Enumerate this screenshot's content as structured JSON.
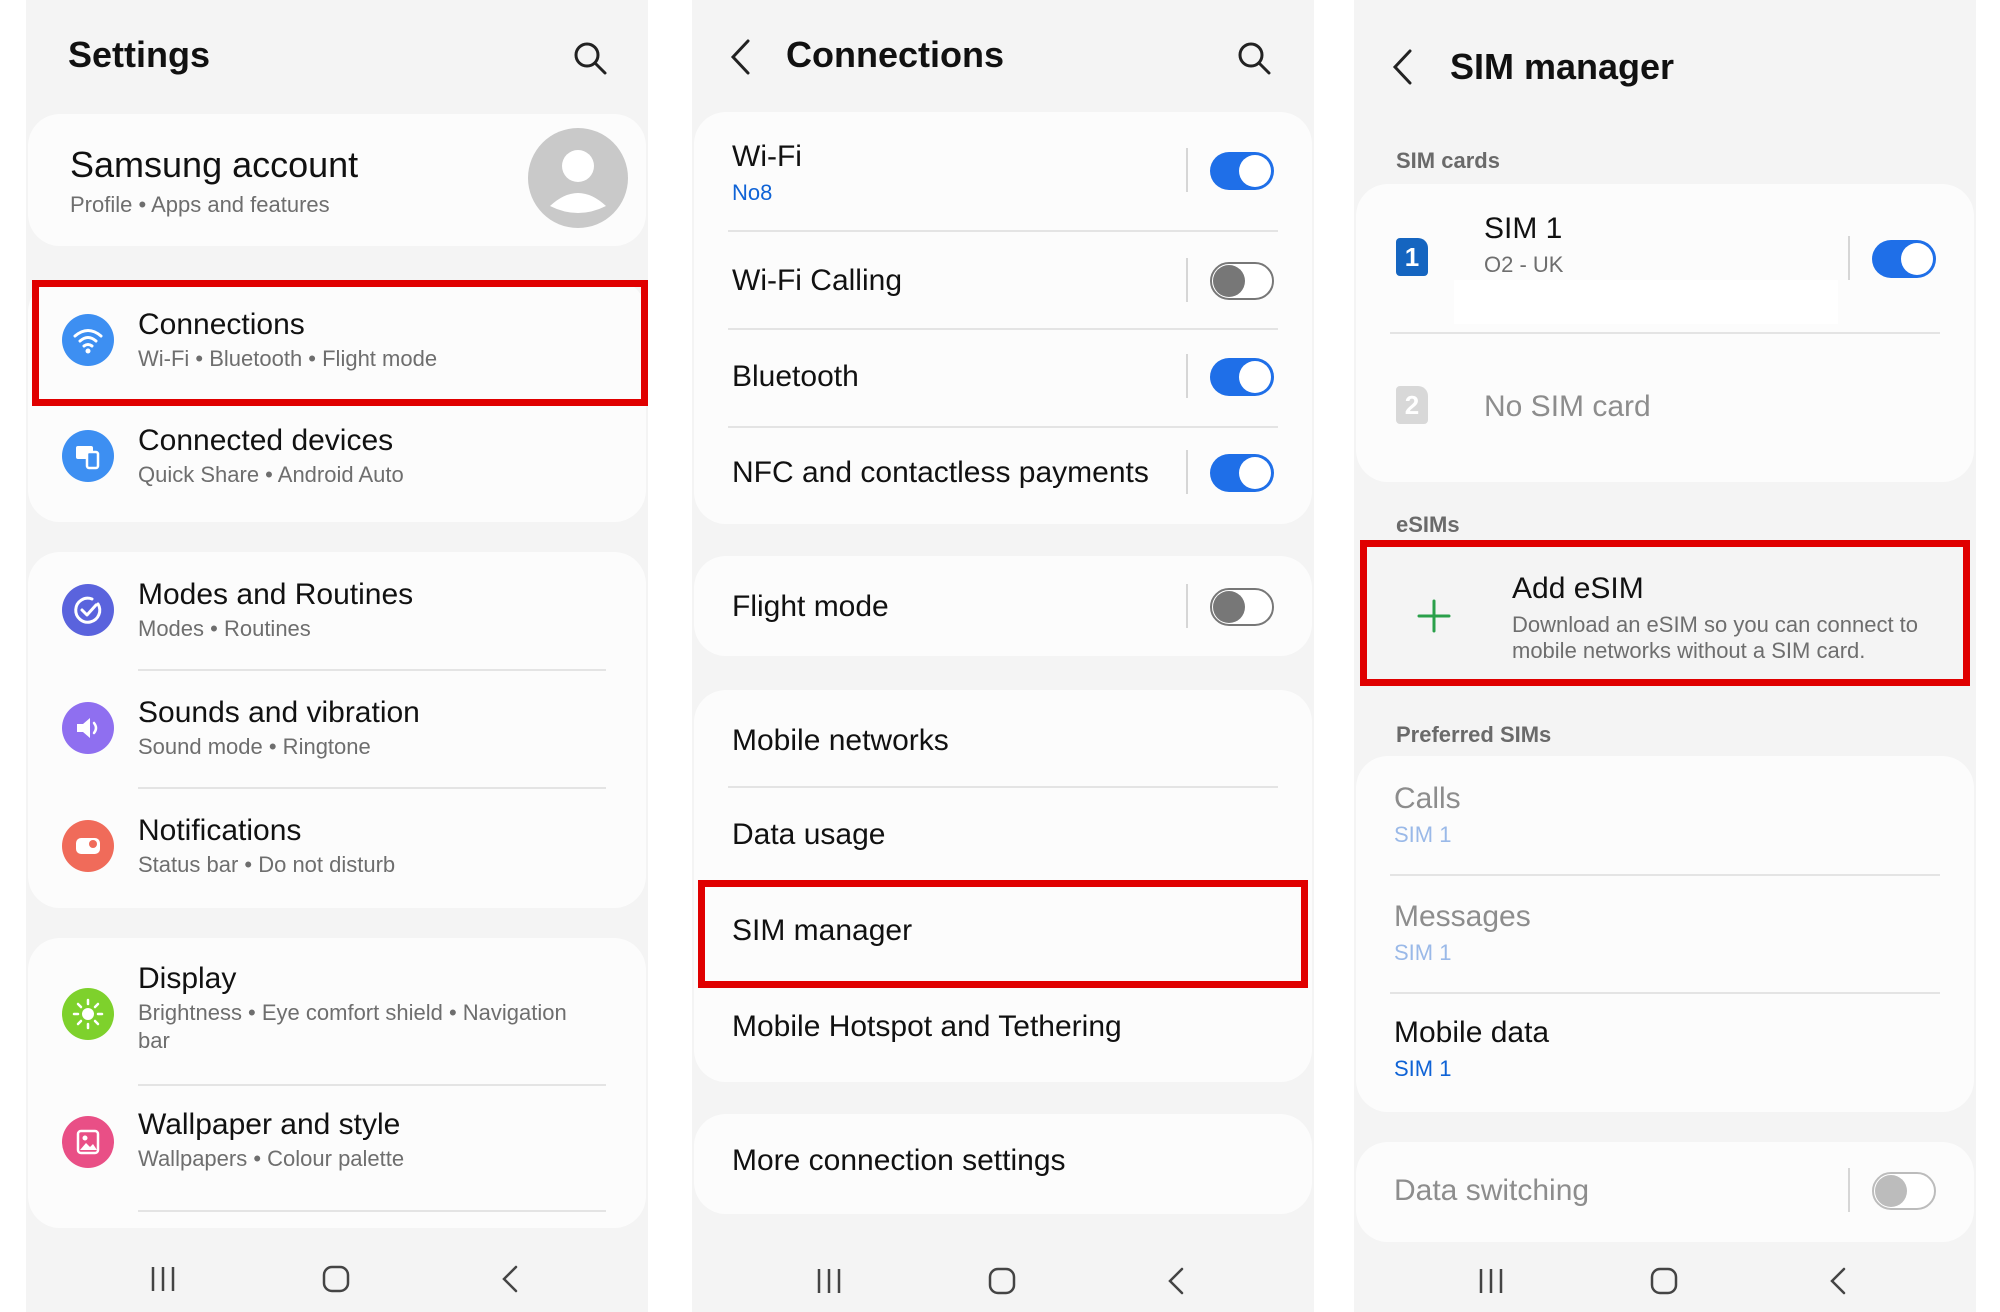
{
  "screen1": {
    "title": "Settings",
    "account": {
      "title": "Samsung account",
      "sub": "Profile  •  Apps and features"
    },
    "items": [
      {
        "icon": "wifi-icon",
        "title": "Connections",
        "sub": "Wi-Fi  •  Bluetooth  •  Flight mode",
        "color": "#3d8ff2"
      },
      {
        "icon": "connected-devices-icon",
        "title": "Connected devices",
        "sub": "Quick Share  •  Android Auto",
        "color": "#3d8ff2"
      },
      {
        "icon": "modes-routines-icon",
        "title": "Modes and Routines",
        "sub": "Modes  •  Routines",
        "color": "#5a63dd"
      },
      {
        "icon": "sound-icon",
        "title": "Sounds and vibration",
        "sub": "Sound mode  •  Ringtone",
        "color": "#8f6ff0"
      },
      {
        "icon": "notifications-icon",
        "title": "Notifications",
        "sub": "Status bar  •  Do not disturb",
        "color": "#f06b5a"
      },
      {
        "icon": "display-icon",
        "title": "Display",
        "sub_line1": "Brightness  •  Eye comfort shield  •  Navigation",
        "sub_line2": "bar",
        "color": "#7ed12c"
      },
      {
        "icon": "wallpaper-icon",
        "title": "Wallpaper and style",
        "sub": "Wallpapers  •  Colour palette",
        "color": "#e94f86"
      }
    ]
  },
  "screen2": {
    "title": "Connections",
    "items": [
      {
        "title": "Wi-Fi",
        "sub": "No8",
        "toggle": "on"
      },
      {
        "title": "Wi-Fi Calling",
        "toggle": "off"
      },
      {
        "title": "Bluetooth",
        "toggle": "on"
      },
      {
        "title": "NFC and contactless payments",
        "toggle": "on"
      },
      {
        "title": "Flight mode",
        "toggle": "off"
      },
      {
        "title": "Mobile networks"
      },
      {
        "title": "Data usage"
      },
      {
        "title": "SIM manager"
      },
      {
        "title": "Mobile Hotspot and Tethering"
      },
      {
        "title": "More connection settings"
      }
    ]
  },
  "screen3": {
    "title": "SIM manager",
    "sim_cards_label": "SIM cards",
    "sim1": {
      "badge": "1",
      "title": "SIM 1",
      "sub": "O2 - UK",
      "toggle": "on"
    },
    "sim2": {
      "badge": "2",
      "title": "No SIM card"
    },
    "esims_label": "eSIMs",
    "add_esim": {
      "title": "Add eSIM",
      "desc_line1": "Download an eSIM so you can connect to",
      "desc_line2": "mobile networks without a SIM card."
    },
    "preferred_label": "Preferred SIMs",
    "preferred": [
      {
        "title": "Calls",
        "sub": "SIM 1"
      },
      {
        "title": "Messages",
        "sub": "SIM 1"
      },
      {
        "title": "Mobile data",
        "sub": "SIM 1"
      }
    ],
    "data_switching": {
      "title": "Data switching",
      "toggle": "off"
    }
  },
  "colors": {
    "accent": "#1f6fe8",
    "highlight": "#e00000",
    "add_green": "#2aa04a",
    "sim_badge": "#1565c0"
  }
}
